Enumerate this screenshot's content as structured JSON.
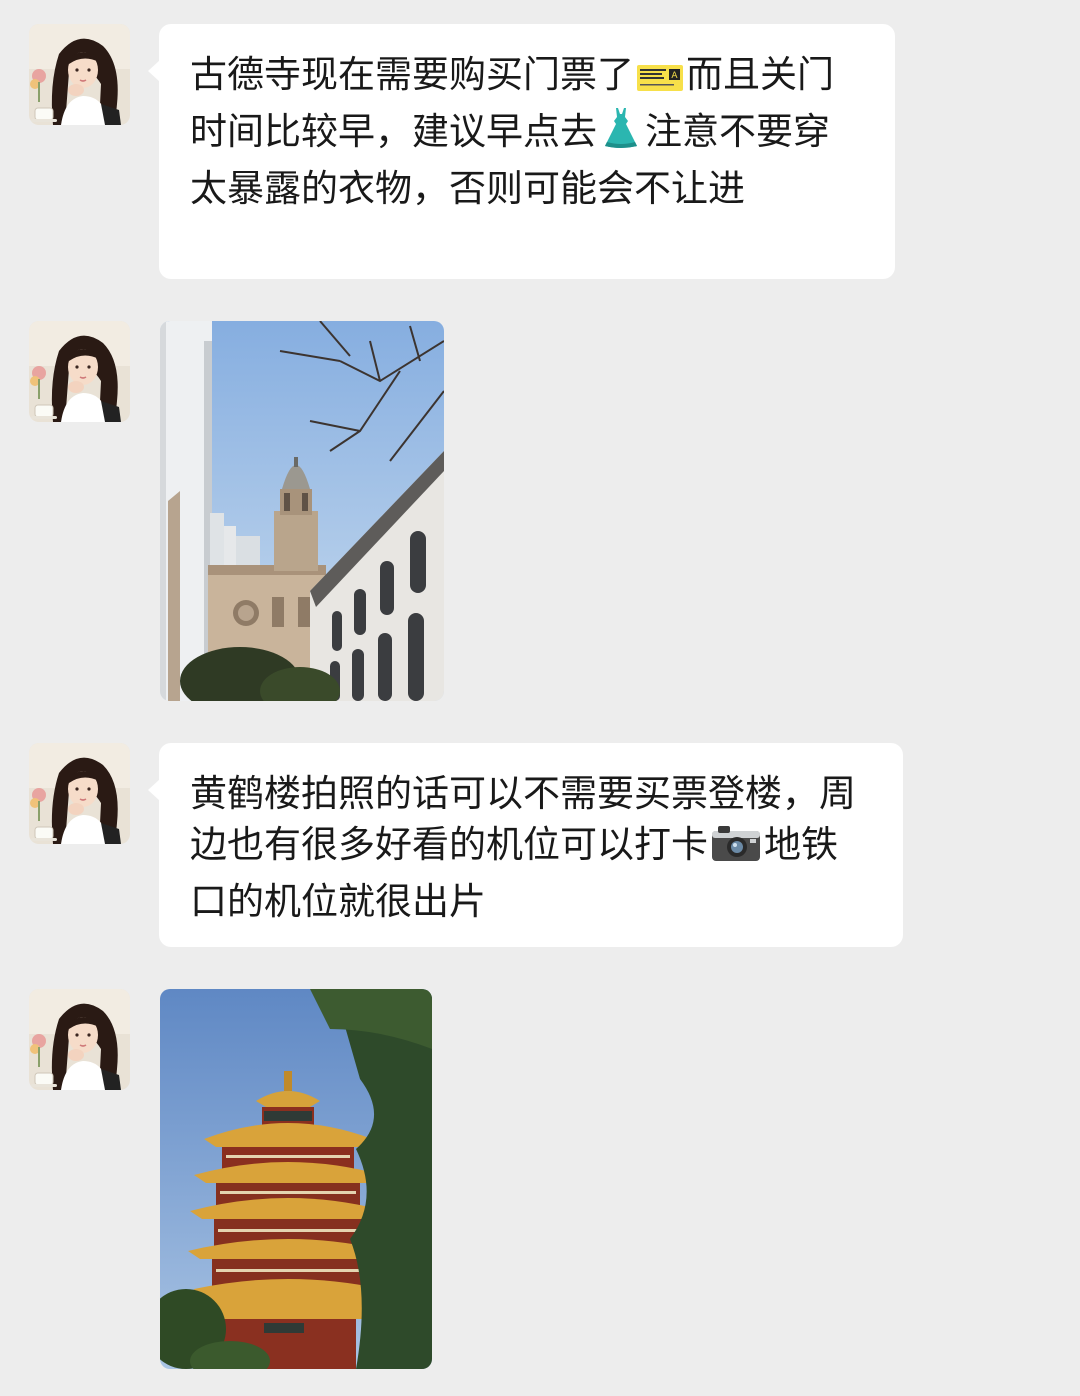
{
  "chat": {
    "messages": [
      {
        "type": "text",
        "sender_avatar_icon": "user-avatar",
        "text_parts": [
          "古德寺现在需要购买门票了",
          "而且关门时间比较早，建议早点去",
          "注意不要穿太暴露的衣物，否则可能会不让进"
        ],
        "emojis": [
          "ticket-emoji",
          "dress-emoji"
        ]
      },
      {
        "type": "image",
        "sender_avatar_icon": "user-avatar",
        "image_subject": "gude-temple-photo"
      },
      {
        "type": "text",
        "sender_avatar_icon": "user-avatar",
        "text_parts": [
          "黄鹤楼拍照的话可以不需要买票登楼，周边也有很多好看的机位可以打卡",
          "地铁口的机位就很出片"
        ],
        "emojis": [
          "camera-emoji"
        ]
      },
      {
        "type": "image",
        "sender_avatar_icon": "user-avatar",
        "image_subject": "yellow-crane-tower-photo"
      }
    ]
  },
  "colors": {
    "background": "#ededed",
    "bubble": "#ffffff",
    "text": "#191919"
  }
}
